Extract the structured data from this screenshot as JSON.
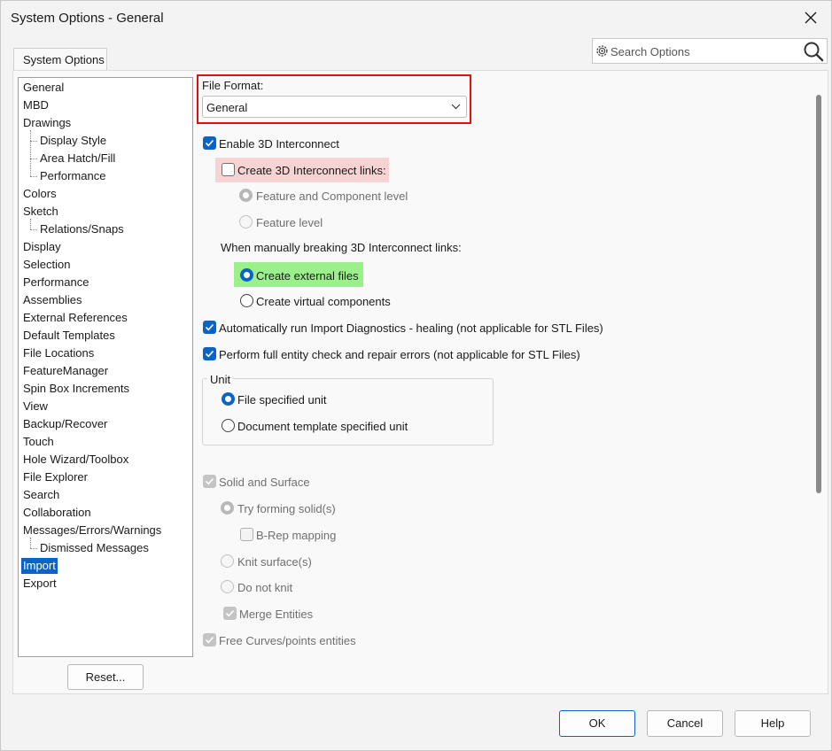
{
  "window": {
    "title": "System Options - General"
  },
  "tab": {
    "label": "System Options"
  },
  "search": {
    "placeholder": "Search Options"
  },
  "tree": {
    "items": [
      {
        "label": "General",
        "level": 0
      },
      {
        "label": "MBD",
        "level": 0
      },
      {
        "label": "Drawings",
        "level": 0
      },
      {
        "label": "Display Style",
        "level": 1
      },
      {
        "label": "Area Hatch/Fill",
        "level": 1
      },
      {
        "label": "Performance",
        "level": 1
      },
      {
        "label": "Colors",
        "level": 0
      },
      {
        "label": "Sketch",
        "level": 0
      },
      {
        "label": "Relations/Snaps",
        "level": 1
      },
      {
        "label": "Display",
        "level": 0
      },
      {
        "label": "Selection",
        "level": 0
      },
      {
        "label": "Performance",
        "level": 0
      },
      {
        "label": "Assemblies",
        "level": 0
      },
      {
        "label": "External References",
        "level": 0
      },
      {
        "label": "Default Templates",
        "level": 0
      },
      {
        "label": "File Locations",
        "level": 0
      },
      {
        "label": "FeatureManager",
        "level": 0
      },
      {
        "label": "Spin Box Increments",
        "level": 0
      },
      {
        "label": "View",
        "level": 0
      },
      {
        "label": "Backup/Recover",
        "level": 0
      },
      {
        "label": "Touch",
        "level": 0
      },
      {
        "label": "Hole Wizard/Toolbox",
        "level": 0
      },
      {
        "label": "File Explorer",
        "level": 0
      },
      {
        "label": "Search",
        "level": 0
      },
      {
        "label": "Collaboration",
        "level": 0
      },
      {
        "label": "Messages/Errors/Warnings",
        "level": 0
      },
      {
        "label": "Dismissed Messages",
        "level": 1
      },
      {
        "label": "Import",
        "level": 0,
        "selected": true
      },
      {
        "label": "Export",
        "level": 0
      }
    ]
  },
  "reset_label": "Reset...",
  "file_format": {
    "label": "File Format:",
    "value": "General"
  },
  "options": {
    "enable_3d_interconnect": "Enable 3D Interconnect",
    "create_links": "Create 3D Interconnect links:",
    "feature_component_level": "Feature and Component level",
    "feature_level": "Feature level",
    "manual_break_label": "When manually breaking 3D Interconnect links:",
    "create_external_files": "Create external files",
    "create_virtual_components": "Create virtual components",
    "auto_import_diagnostics": "Automatically run Import Diagnostics - healing (not applicable for STL Files)",
    "full_entity_check": "Perform full entity check and repair errors (not applicable for STL Files)"
  },
  "unit_group": {
    "label": "Unit",
    "file_specified": "File specified unit",
    "document_template": "Document template specified unit"
  },
  "solid_surface": {
    "label": "Solid and Surface",
    "try_forming": "Try forming solid(s)",
    "brep_mapping": "B-Rep mapping",
    "knit_surfaces": "Knit surface(s)",
    "do_not_knit": "Do not knit",
    "merge_entities": "Merge Entities",
    "free_curves": "Free Curves/points entities"
  },
  "footer": {
    "ok": "OK",
    "cancel": "Cancel",
    "help": "Help"
  },
  "colors": {
    "accent": "#0a64c8",
    "highlight_red": "#e01010",
    "highlight_pink": "#f8d3d3",
    "highlight_green": "#9bf08c"
  }
}
